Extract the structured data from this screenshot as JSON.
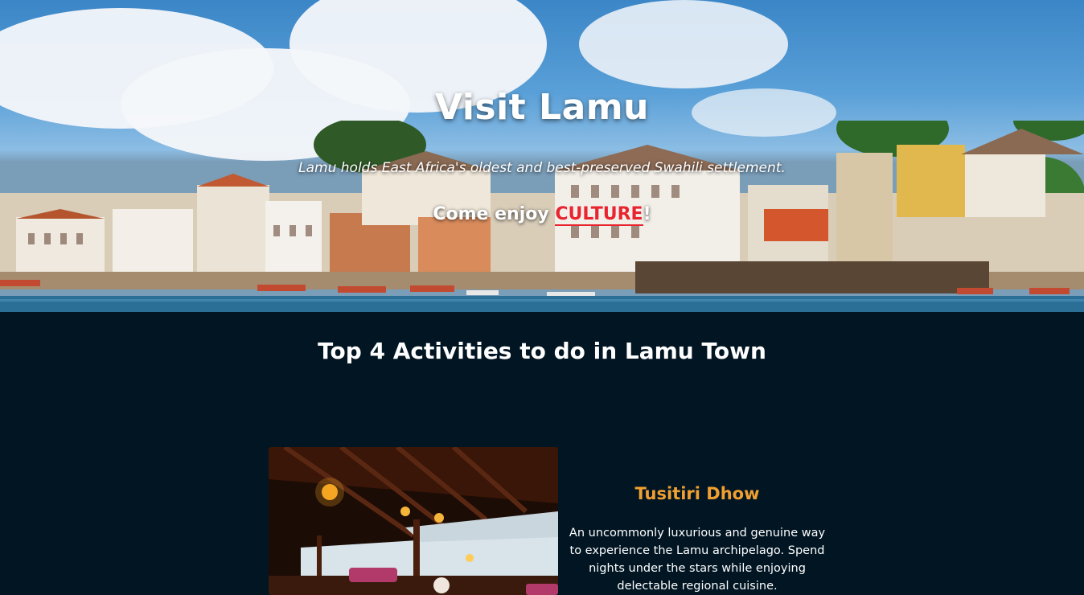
{
  "hero": {
    "title": "Visit Lamu",
    "subtitle": "Lamu holds East Africa's oldest and best-preserved Swahili settlement.",
    "cta_prefix": "Come enjoy ",
    "cta_accent": "CULTURE",
    "cta_suffix": "!",
    "image": "lamu-waterfront-photo"
  },
  "section": {
    "title": "Top 4 Activities to do in Lamu Town"
  },
  "activities": [
    {
      "name": "Tusitiri Dhow",
      "description": "An uncommonly luxurious and genuine way to experience the Lamu archipelago. Spend nights under the stars while enjoying delectable regional cuisine.",
      "image": "dhow-interior-photo"
    }
  ],
  "colors": {
    "background": "#011523",
    "accent_red": "#e8242e",
    "activity_title": "#f0a030"
  }
}
